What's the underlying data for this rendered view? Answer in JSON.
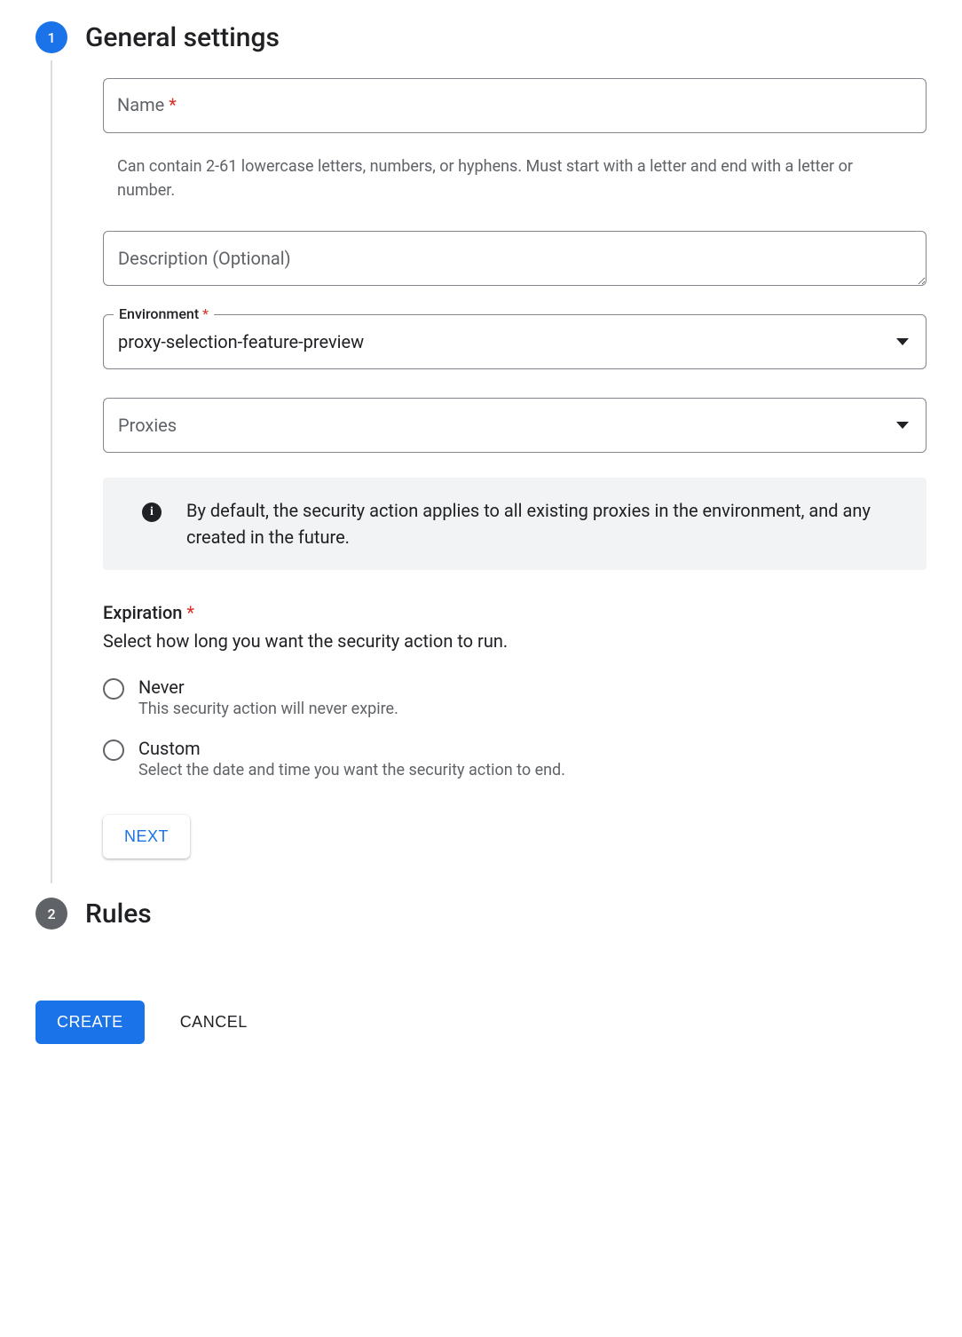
{
  "steps": {
    "s1": {
      "num": "1",
      "title": "General settings"
    },
    "s2": {
      "num": "2",
      "title": "Rules"
    }
  },
  "fields": {
    "name": {
      "label": "Name",
      "required": "*",
      "helper": "Can contain 2-61 lowercase letters, numbers, or hyphens. Must start with a letter and end with a letter or number."
    },
    "description": {
      "placeholder": "Description (Optional)"
    },
    "environment": {
      "label": "Environment",
      "required": "*",
      "value": "proxy-selection-feature-preview"
    },
    "proxies": {
      "placeholder": "Proxies"
    }
  },
  "infoBanner": "By default, the security action applies to all existing proxies in the environment, and any created in the future.",
  "expiration": {
    "label": "Expiration",
    "required": "*",
    "sub": "Select how long you want the security action to run.",
    "options": {
      "never": {
        "title": "Never",
        "sub": "This security action will never expire."
      },
      "custom": {
        "title": "Custom",
        "sub": "Select the date and time you want the security action to end."
      }
    }
  },
  "buttons": {
    "next": "NEXT",
    "create": "CREATE",
    "cancel": "CANCEL"
  }
}
